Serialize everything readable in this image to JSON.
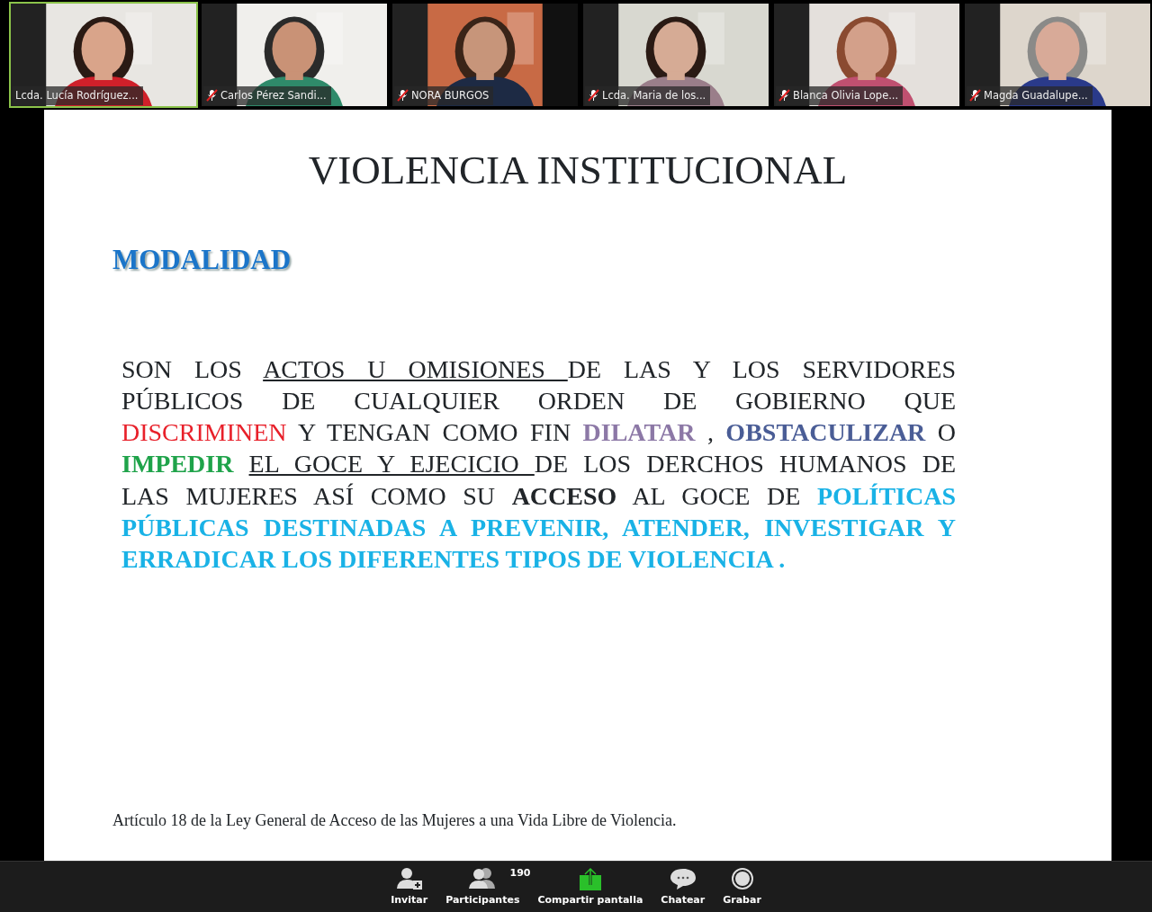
{
  "participants": [
    {
      "name": "Lcda. Lucía Rodríguez...",
      "muted": false,
      "active": true
    },
    {
      "name": "Carlos Pérez Sandi...",
      "muted": true,
      "active": false
    },
    {
      "name": "NORA BURGOS",
      "muted": true,
      "active": false
    },
    {
      "name": "Lcda. Maria de los...",
      "muted": true,
      "active": false
    },
    {
      "name": "Blanca Olivia Lope...",
      "muted": true,
      "active": false
    },
    {
      "name": "Magda Guadalupe...",
      "muted": true,
      "active": false
    }
  ],
  "slide": {
    "title": "VIOLENCIA INSTITUCIONAL",
    "subtitle": "MODALIDAD",
    "paragraph_lines": [
      [
        {
          "kind": "plain",
          "text": "SON LOS "
        },
        {
          "kind": "underline",
          "text": "ACTOS U OMISIONES "
        },
        {
          "kind": "plain",
          "text": "DE LAS Y LOS SERVIDORES"
        }
      ],
      [
        {
          "kind": "plain",
          "text": "PÚBLICOS DE CUALQUIER ORDEN DE GOBIERNO QUE"
        }
      ],
      [
        {
          "kind": "colored",
          "text": "DISCRIMINEN",
          "color": "#e8202a"
        },
        {
          "kind": "plain",
          "text": " Y TENGAN COMO FIN "
        },
        {
          "kind": "highlight",
          "text": "DILATAR",
          "color": "#8c78a6"
        },
        {
          "kind": "plain",
          "text": " , "
        },
        {
          "kind": "highlight",
          "text": "OBSTACULIZAR",
          "color": "#4a5d96"
        },
        {
          "kind": "plain",
          "text": " O"
        }
      ],
      [
        {
          "kind": "highlight",
          "text": "IMPEDIR ",
          "color": "#1fa34a"
        },
        {
          "kind": "underline",
          "text": "EL GOCE  Y EJECICIO "
        },
        {
          "kind": "plain",
          "text": "DE LOS DERCHOS HUMANOS DE"
        }
      ],
      [
        {
          "kind": "plain",
          "text": "LAS MUJERES ASÍ COMO SU "
        },
        {
          "kind": "bold",
          "text": "ACCESO"
        },
        {
          "kind": "plain",
          "text": " AL GOCE DE "
        },
        {
          "kind": "highlight",
          "text": "POLÍTICAS",
          "color": "#19b2e6"
        }
      ],
      [
        {
          "kind": "highlight",
          "text": "PÚBLICAS  DESTINADAS A PREVENIR, ATENDER, INVESTIGAR Y",
          "color": "#19b2e6"
        }
      ],
      [
        {
          "kind": "highlight",
          "text": "ERRADICAR  LOS DIFERENTES TIPOS DE VIOLENCIA .",
          "color": "#19b2e6"
        }
      ]
    ],
    "citation": "Artículo 18 de la Ley General de Acceso de las Mujeres a una Vida Libre de Violencia."
  },
  "toolbar": [
    {
      "kind": "invite",
      "label": "Invitar"
    },
    {
      "kind": "participants",
      "label": "Participantes",
      "count": "190"
    },
    {
      "kind": "share",
      "label": "Compartir pantalla"
    },
    {
      "kind": "chat",
      "label": "Chatear"
    },
    {
      "kind": "record",
      "label": "Grabar"
    }
  ]
}
